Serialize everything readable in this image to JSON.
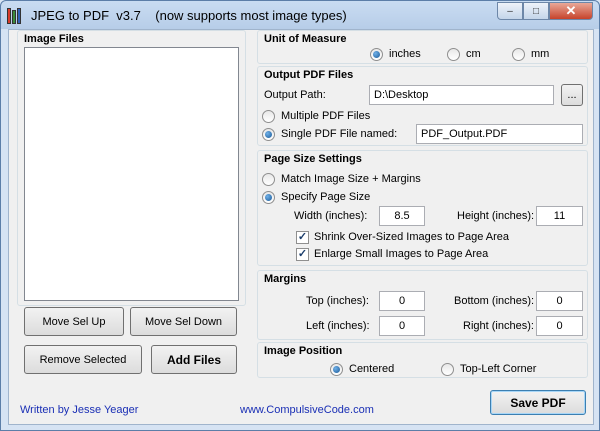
{
  "window": {
    "title": "JPEG to PDF  v3.7    (now supports most image types)",
    "min_glyph": "–",
    "max_glyph": "□",
    "close_glyph": "✕"
  },
  "image_files": {
    "title": "Image Files",
    "move_up": "Move Sel Up",
    "move_down": "Move Sel Down",
    "remove": "Remove Selected",
    "add": "Add Files"
  },
  "unit": {
    "title": "Unit of Measure",
    "options": [
      "inches",
      "cm",
      "mm"
    ],
    "selected": "inches"
  },
  "output": {
    "title": "Output PDF Files",
    "path_label": "Output Path:",
    "path_value": "D:\\Desktop",
    "browse_label": "...",
    "multiple_label": "Multiple PDF Files",
    "single_label": "Single PDF File named:",
    "single_value": "PDF_Output.PDF",
    "selected": "single"
  },
  "page_size": {
    "title": "Page Size Settings",
    "match_label": "Match Image Size + Margins",
    "specify_label": "Specify Page Size",
    "selected": "specify",
    "width_label": "Width (inches):",
    "width_value": "8.5",
    "height_label": "Height (inches):",
    "height_value": "11",
    "shrink_label": "Shrink Over-Sized Images to Page Area",
    "shrink_checked": true,
    "enlarge_label": "Enlarge Small Images to Page Area",
    "enlarge_checked": true
  },
  "margins": {
    "title": "Margins",
    "top_label": "Top (inches):",
    "top_value": "0",
    "bottom_label": "Bottom (inches):",
    "bottom_value": "0",
    "left_label": "Left (inches):",
    "left_value": "0",
    "right_label": "Right (inches):",
    "right_value": "0"
  },
  "position": {
    "title": "Image Position",
    "centered_label": "Centered",
    "topleft_label": "Top-Left Corner",
    "selected": "centered"
  },
  "footer": {
    "author": "Written by Jesse Yeager",
    "website": "www.CompulsiveCode.com",
    "save_label": "Save PDF"
  },
  "colors": {
    "link": "#1a2fb5",
    "radio_accent": "#1b5a98"
  }
}
